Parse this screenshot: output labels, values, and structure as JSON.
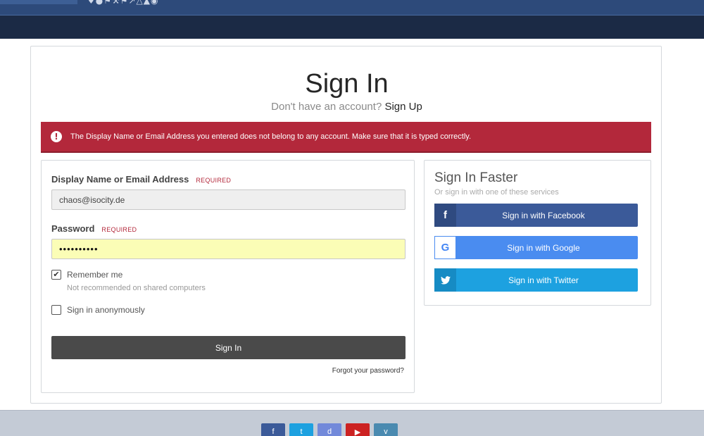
{
  "header": {
    "logo_icons": "♦●⚑⚒⚑↗△▲◉"
  },
  "main": {
    "title": "Sign In",
    "subtitle_prefix": "Don't have an account?",
    "signup_link": "Sign Up",
    "error_message": "The Display Name or Email Address you entered does not belong to any account. Make sure that it is typed correctly."
  },
  "form": {
    "email_label": "Display Name or Email Address",
    "required": "REQUIRED",
    "email_value": "chaos@isocity.de",
    "password_label": "Password",
    "password_value": "••••••••••",
    "remember_label": "Remember me",
    "remember_checked": true,
    "remember_hint": "Not recommended on shared computers",
    "anonymous_label": "Sign in anonymously",
    "anonymous_checked": false,
    "submit_label": "Sign In",
    "forgot_label": "Forgot your password?"
  },
  "faster": {
    "title": "Sign In Faster",
    "subtitle": "Or sign in with one of these services",
    "facebook_label": "Sign in with Facebook",
    "google_label": "Sign in with Google",
    "twitter_label": "Sign in with Twitter"
  },
  "footer": {
    "social_icons": [
      "facebook-icon",
      "twitter-icon",
      "discord-icon",
      "youtube-icon",
      "vimeo-icon"
    ]
  },
  "colors": {
    "error": "#b3283b",
    "facebook": "#3b5a99",
    "google": "#4a8cf0",
    "twitter": "#1da1e0",
    "submit": "#4a4a4a",
    "navbar": "#1b2a45"
  }
}
